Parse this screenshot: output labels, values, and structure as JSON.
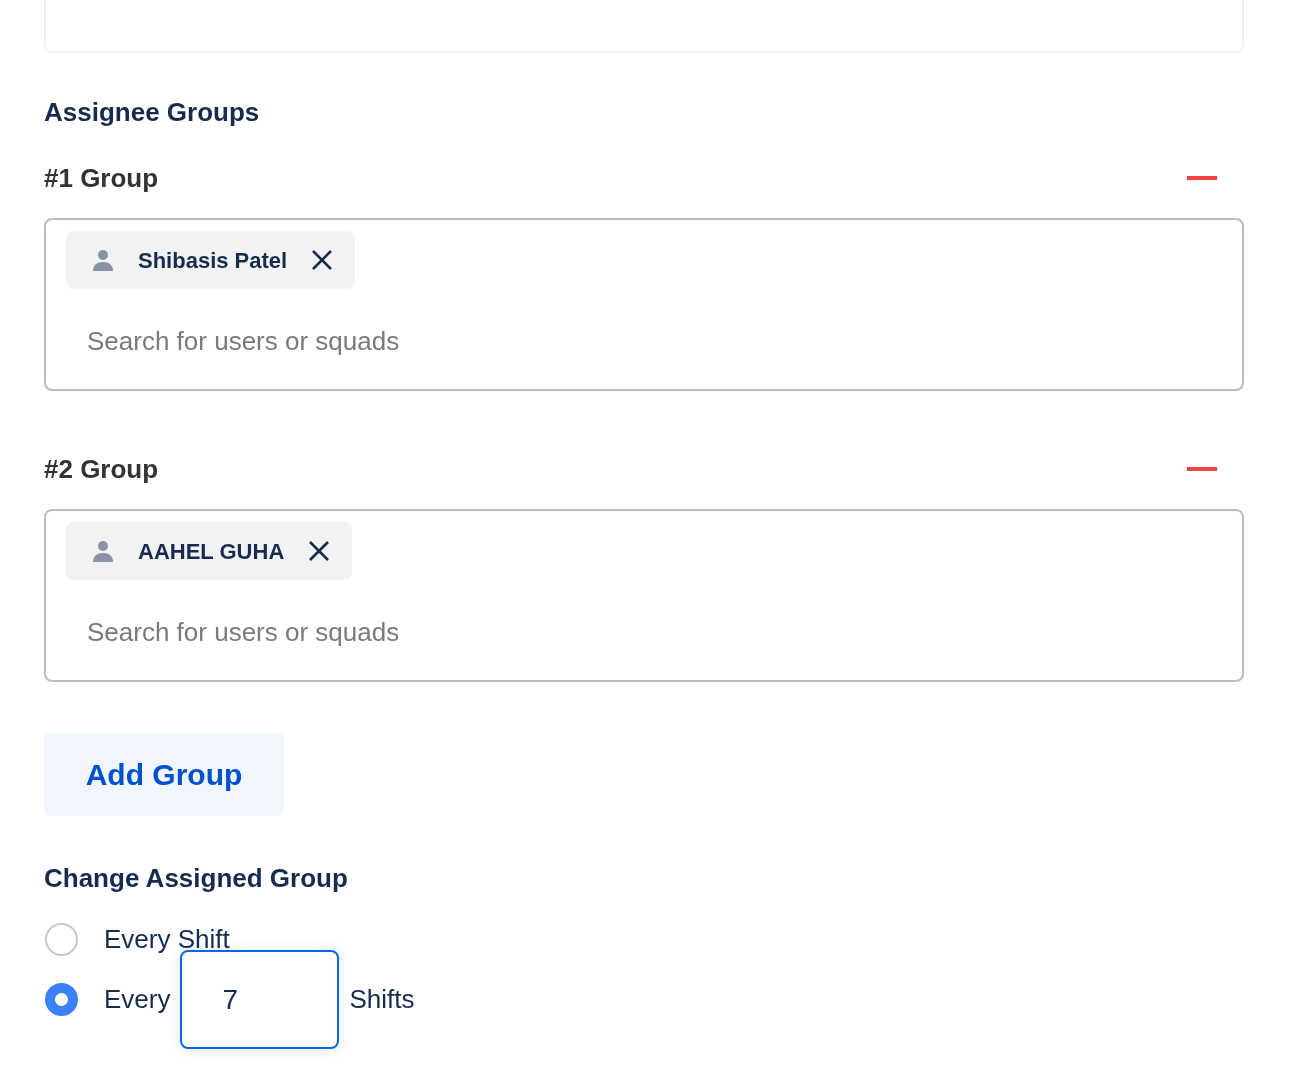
{
  "section_title": "Assignee Groups",
  "groups": [
    {
      "label": "#1 Group",
      "members": [
        {
          "name": "Shibasis Patel"
        }
      ],
      "placeholder": "Search for users or squads"
    },
    {
      "label": "#2 Group",
      "members": [
        {
          "name": "AAHEL GUHA"
        }
      ],
      "placeholder": "Search for users or squads"
    }
  ],
  "add_button": "Add Group",
  "change_section": {
    "title": "Change Assigned Group",
    "options": [
      {
        "kind": "plain",
        "label": "Every Shift",
        "selected": false
      },
      {
        "kind": "interval",
        "label": "Every",
        "value": "7",
        "suffix": "Shifts",
        "selected": true
      }
    ]
  }
}
